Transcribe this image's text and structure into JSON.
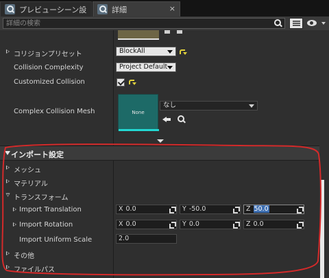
{
  "tabs": [
    {
      "label": "プレビューシーン設",
      "icon": "details-icon",
      "close": "×"
    },
    {
      "label": "詳細",
      "icon": "details-icon",
      "close": "×"
    }
  ],
  "search": {
    "placeholder": "詳細の検索",
    "value": ""
  },
  "properties": {
    "collision_preset": {
      "label": "コリジョンプリセット",
      "value": "BlockAll"
    },
    "collision_complexity": {
      "label": "Collision Complexity",
      "value": "Project Default"
    },
    "customized_collision": {
      "label": "Customized Collision",
      "checked": true
    },
    "complex_collision_mesh": {
      "label": "Complex Collision Mesh",
      "thumbnail_text": "None",
      "value": "なし"
    }
  },
  "import_settings": {
    "title": "インポート設定",
    "categories": {
      "mesh": "メッシュ",
      "material": "マテリアル",
      "transform": "トランスフォーム",
      "misc": "その他",
      "filepath": "ファイルパス"
    },
    "translation": {
      "label": "Import Translation",
      "x_axis": "X",
      "x": "0.0",
      "y_axis": "Y",
      "y": "-50.0",
      "z_axis": "Z",
      "z": "50.0"
    },
    "rotation": {
      "label": "Import Rotation",
      "x_axis": "X",
      "x": "0.0",
      "y_axis": "Y",
      "y": "0.0",
      "z_axis": "Z",
      "z": "0.0"
    },
    "uniform_scale": {
      "label": "Import Uniform Scale",
      "value": "2.0"
    }
  },
  "colors": {
    "annotation": "#d42a2a",
    "mesh_thumb": "#1d6a67",
    "reset_icon": "#e0d13c"
  }
}
